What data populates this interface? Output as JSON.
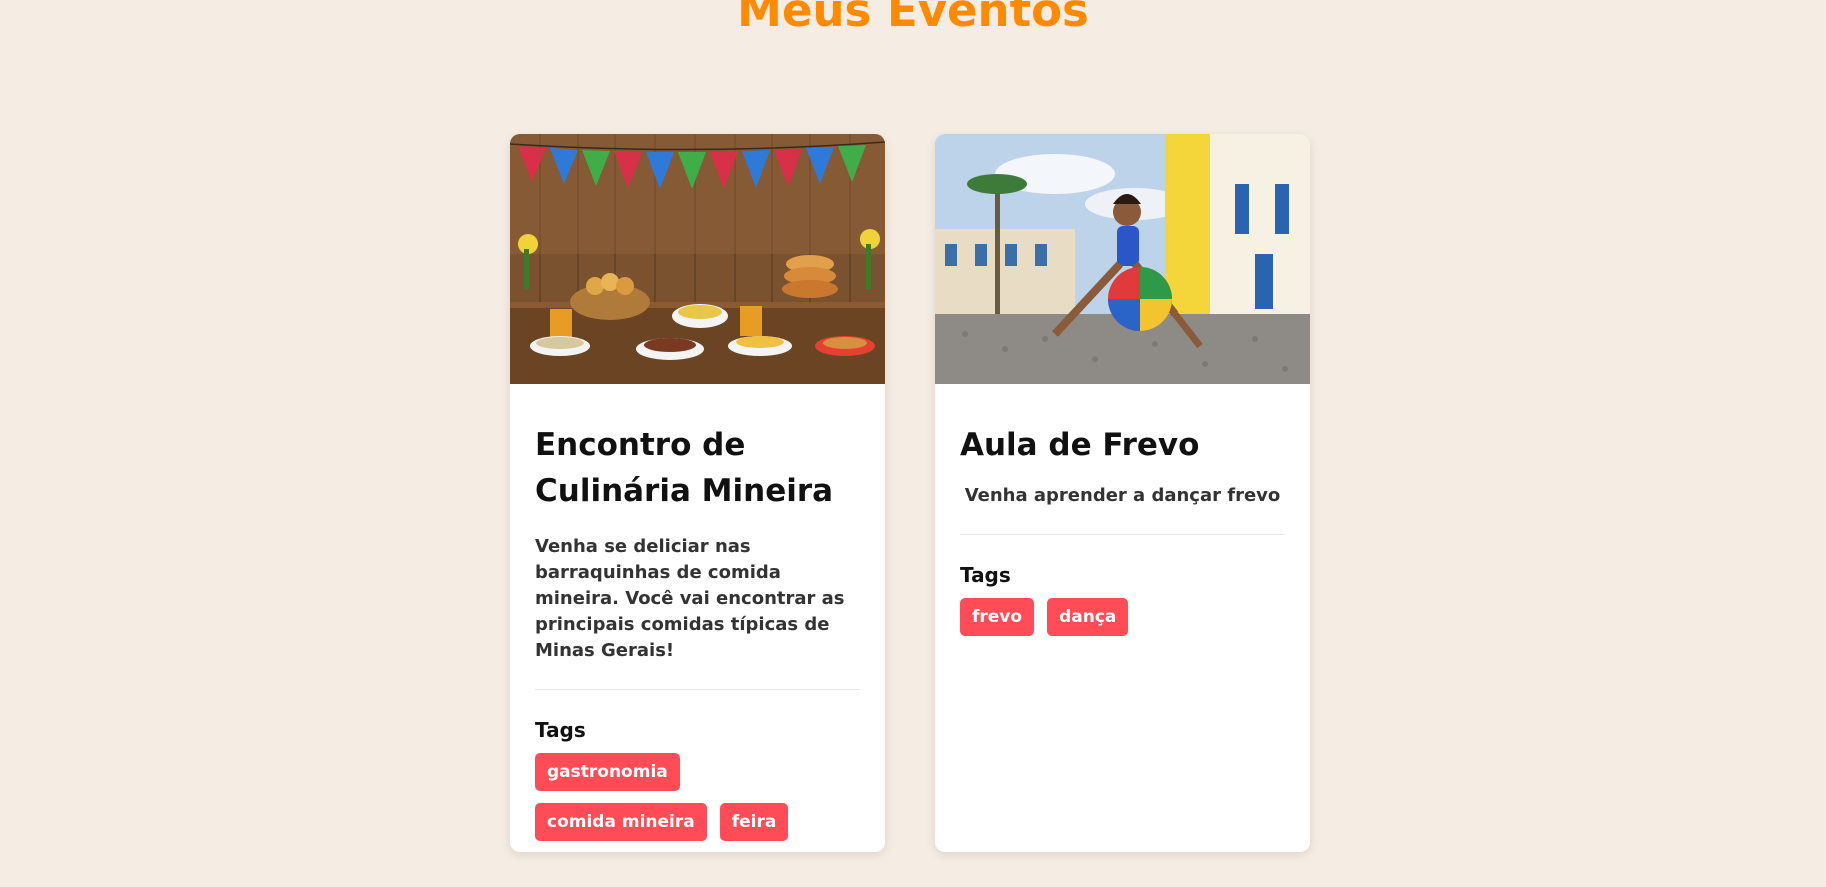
{
  "page": {
    "title": "Meus Eventos"
  },
  "events": [
    {
      "title": "Encontro de Culinária Mineira",
      "description": "Venha se deliciar nas barraquinhas de comida mineira. Você vai encontrar as principais comidas típicas de Minas Gerais!",
      "tags_heading": "Tags",
      "tags": [
        "gastronomia",
        "comida mineira",
        "feira"
      ]
    },
    {
      "title": "Aula de Frevo",
      "description": "Venha aprender a dançar frevo",
      "tags_heading": "Tags",
      "tags": [
        "frevo",
        "dança"
      ]
    }
  ],
  "colors": {
    "background": "#f5ece3",
    "title_accent": "#ff8a00",
    "tag_background": "#ff4c57",
    "card_background": "#ffffff"
  }
}
